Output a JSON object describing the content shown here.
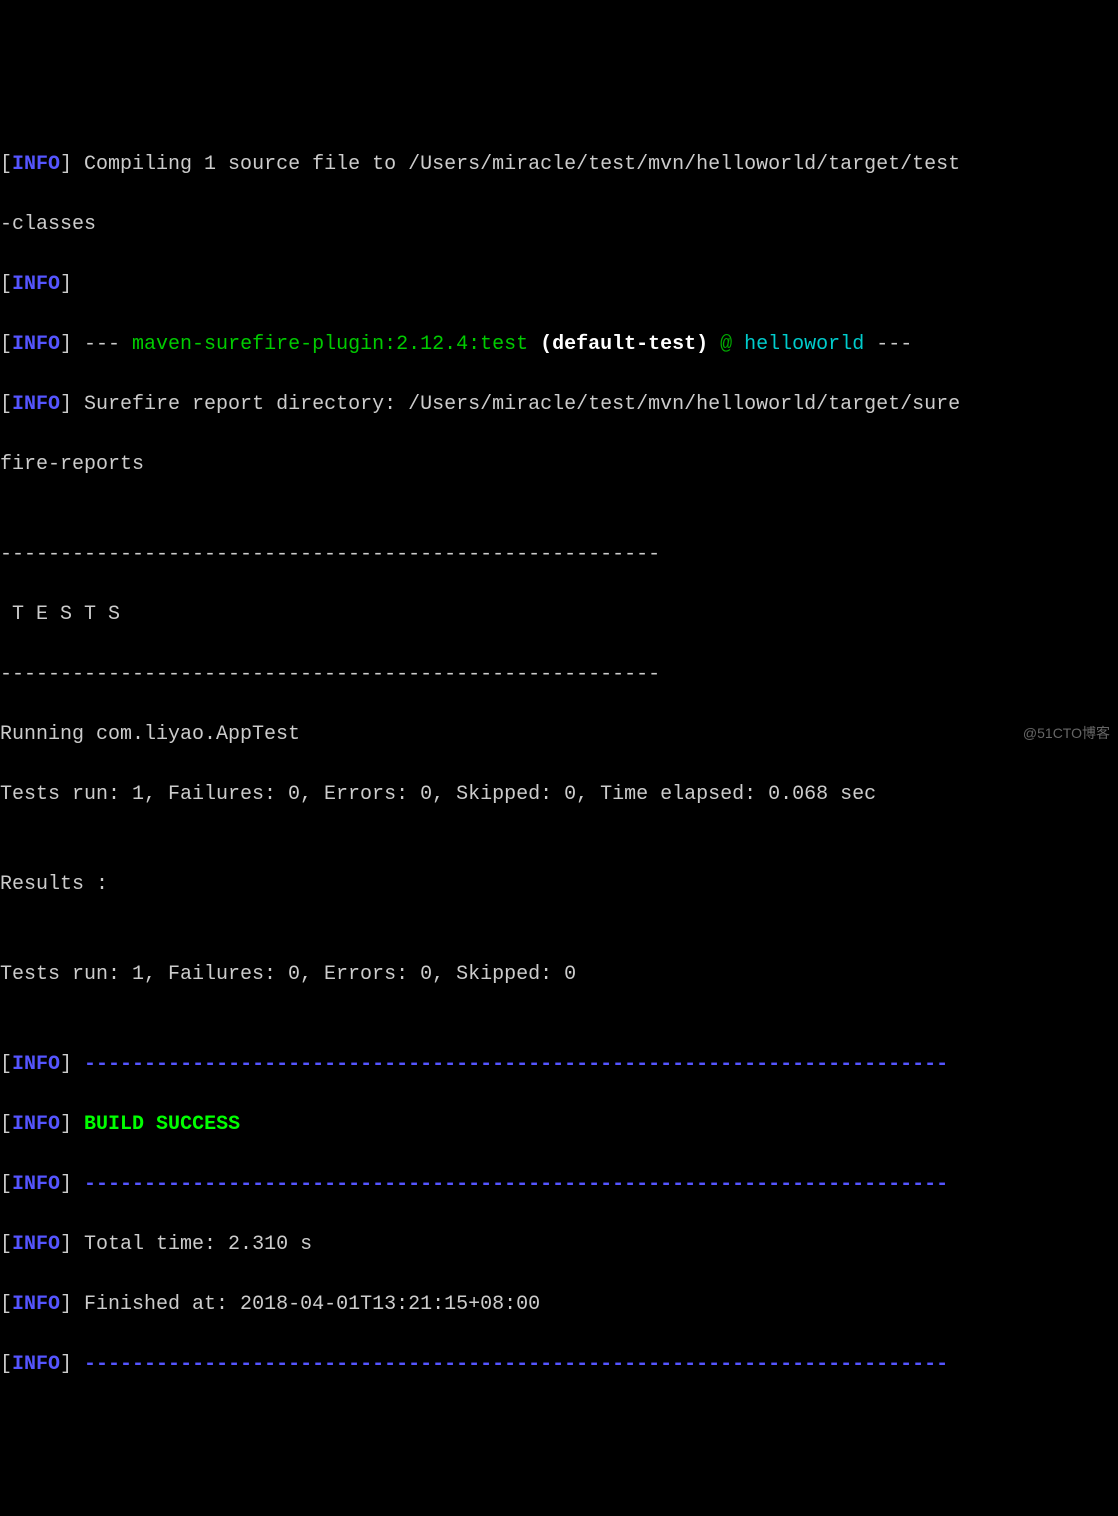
{
  "lines": {
    "l0_open": "[",
    "l0_info": "INFO",
    "l0_close": "] Compiling 1 source file to /Users/miracle/test/mvn/helloworld/target/test",
    "l0_cont": "-classes",
    "l1_open": "[",
    "l1_info": "INFO",
    "l1_close": "]",
    "l2_open": "[",
    "l2_info": "INFO",
    "l2_close": "] --- ",
    "l2_plugin": "maven-surefire-plugin:2.12.4:test",
    "l2_default": " (default-test)",
    "l2_at": " @ ",
    "l2_project": "helloworld",
    "l2_end": " ---",
    "l3_open": "[",
    "l3_info": "INFO",
    "l3_close": "] Surefire report directory: /Users/miracle/test/mvn/helloworld/target/sure",
    "l3_cont": "fire-reports",
    "blank": "",
    "sep": "-------------------------------------------------------",
    "tests_header": " T E S T S",
    "running": "Running com.liyao.AppTest",
    "test_result": "Tests run: 1, Failures: 0, Errors: 0, Skipped: 0, Time elapsed: 0.068 sec",
    "results_label": "Results :",
    "test_summary": "Tests run: 1, Failures: 0, Errors: 0, Skipped: 0",
    "l4_open": "[",
    "l4_info": "INFO",
    "l4_close": "] ",
    "long_sep": "------------------------------------------------------------------------",
    "l5_open": "[",
    "l5_info": "INFO",
    "l5_close": "] ",
    "build_success": "BUILD SUCCESS",
    "l6_open": "[",
    "l6_info": "INFO",
    "l6_close": "] ",
    "l7_open": "[",
    "l7_info": "INFO",
    "l7_close": "] Total time: 2.310 s",
    "l8_open": "[",
    "l8_info": "INFO",
    "l8_close": "] Finished at: 2018-04-01T13:21:15+08:00",
    "l9_open": "[",
    "l9_info": "INFO",
    "l9_close": "] "
  },
  "watermark": "@51CTO博客"
}
